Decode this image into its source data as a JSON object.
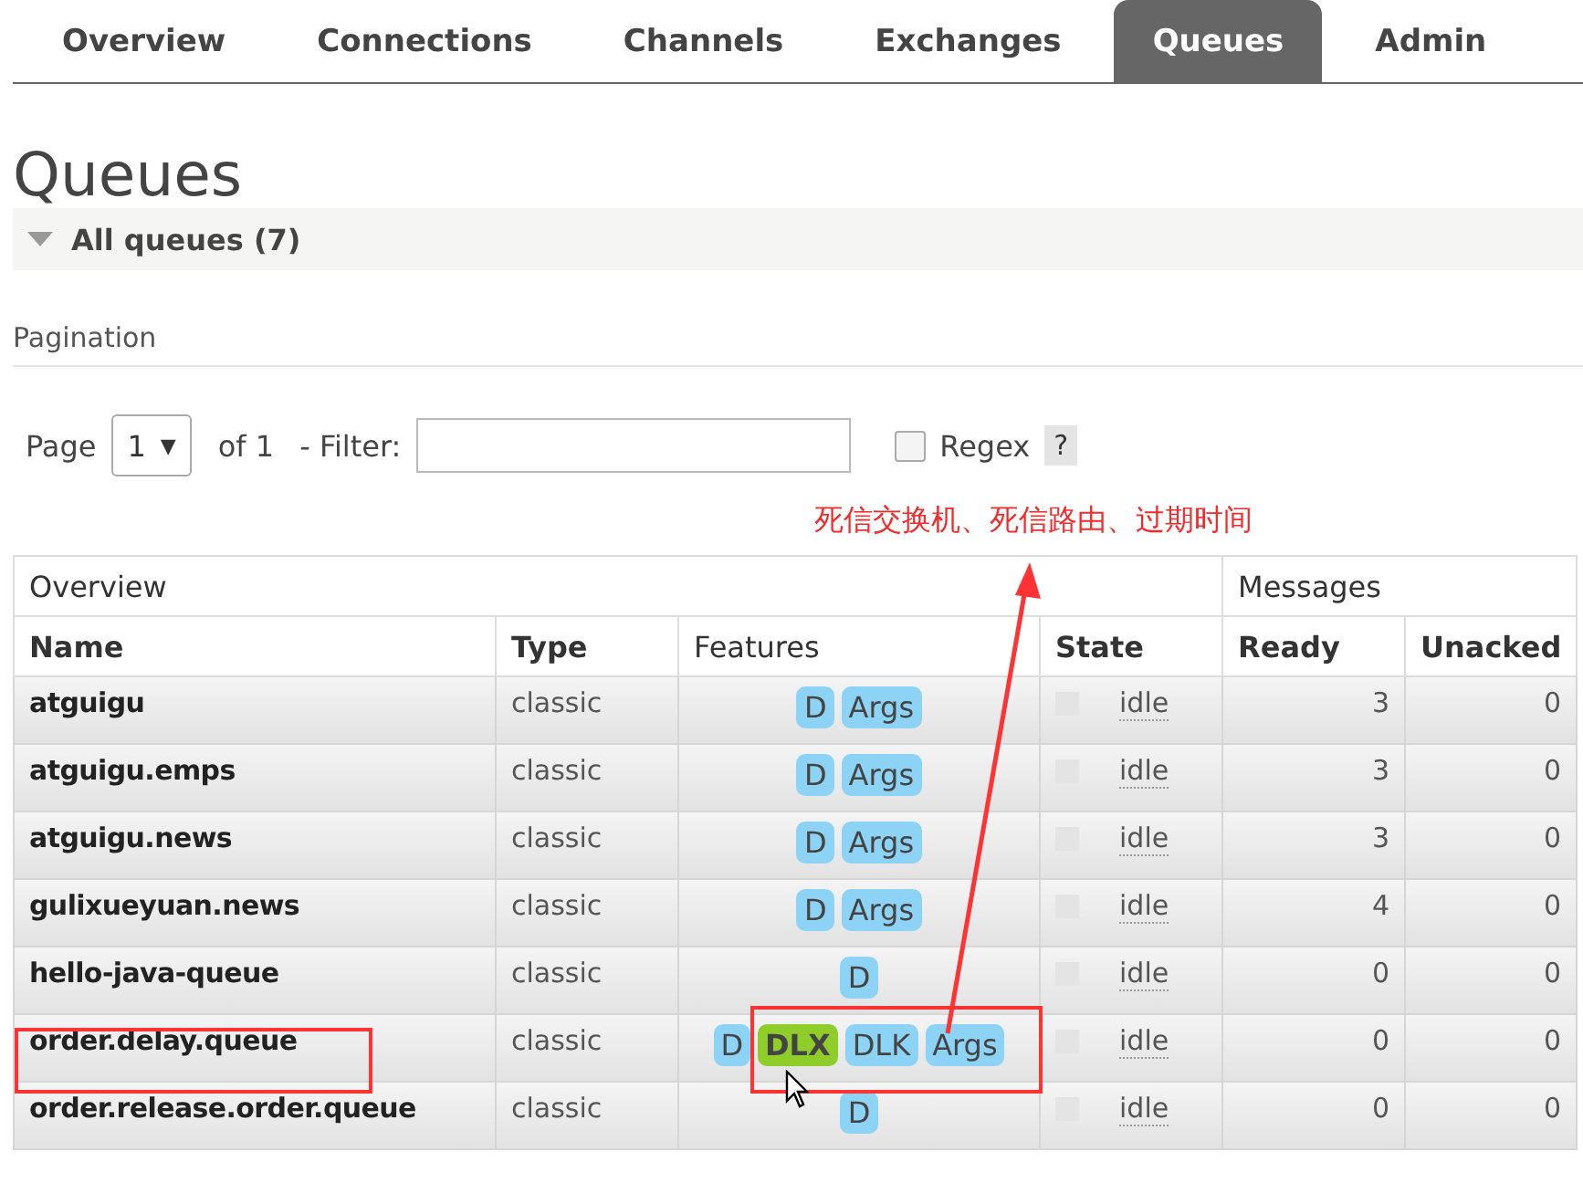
{
  "tabs": [
    {
      "label": "Overview",
      "selected": false
    },
    {
      "label": "Connections",
      "selected": false
    },
    {
      "label": "Channels",
      "selected": false
    },
    {
      "label": "Exchanges",
      "selected": false
    },
    {
      "label": "Queues",
      "selected": true
    },
    {
      "label": "Admin",
      "selected": false
    }
  ],
  "heading": "Queues",
  "section": {
    "title": "All queues (7)",
    "expanded": true
  },
  "pagination": {
    "label": "Pagination",
    "page_label": "Page",
    "page_value": "1",
    "page_caret": "▼",
    "of_label": "of 1",
    "filter_label": "- Filter:",
    "regex_label": "Regex",
    "regex_checked": false,
    "help": "?"
  },
  "annotation": "死信交换机、死信路由、过期时间",
  "table": {
    "groups": [
      "Overview",
      "Messages"
    ],
    "columns": [
      "Name",
      "Type",
      "Features",
      "State",
      "Ready",
      "Unacked"
    ],
    "rows": [
      {
        "name": "atguigu",
        "type": "classic",
        "features": [
          {
            "label": "D",
            "highlighted": false
          },
          {
            "label": "Args",
            "highlighted": false
          }
        ],
        "state": "idle",
        "ready": "3",
        "unacked": "0",
        "marked": false
      },
      {
        "name": "atguigu.emps",
        "type": "classic",
        "features": [
          {
            "label": "D",
            "highlighted": false
          },
          {
            "label": "Args",
            "highlighted": false
          }
        ],
        "state": "idle",
        "ready": "3",
        "unacked": "0",
        "marked": false
      },
      {
        "name": "atguigu.news",
        "type": "classic",
        "features": [
          {
            "label": "D",
            "highlighted": false
          },
          {
            "label": "Args",
            "highlighted": false
          }
        ],
        "state": "idle",
        "ready": "3",
        "unacked": "0",
        "marked": false
      },
      {
        "name": "gulixueyuan.news",
        "type": "classic",
        "features": [
          {
            "label": "D",
            "highlighted": false
          },
          {
            "label": "Args",
            "highlighted": false
          }
        ],
        "state": "idle",
        "ready": "4",
        "unacked": "0",
        "marked": false
      },
      {
        "name": "hello-java-queue",
        "type": "classic",
        "features": [
          {
            "label": "D",
            "highlighted": false
          }
        ],
        "state": "idle",
        "ready": "0",
        "unacked": "0",
        "marked": false
      },
      {
        "name": "order.delay.queue",
        "type": "classic",
        "features": [
          {
            "label": "D",
            "highlighted": false
          },
          {
            "label": "DLX",
            "highlighted": true
          },
          {
            "label": "DLK",
            "highlighted": false
          },
          {
            "label": "Args",
            "highlighted": false
          }
        ],
        "state": "idle",
        "ready": "0",
        "unacked": "0",
        "marked": true
      },
      {
        "name": "order.release.order.queue",
        "type": "classic",
        "features": [
          {
            "label": "D",
            "highlighted": false
          }
        ],
        "state": "idle",
        "ready": "0",
        "unacked": "0",
        "marked": false
      }
    ]
  }
}
